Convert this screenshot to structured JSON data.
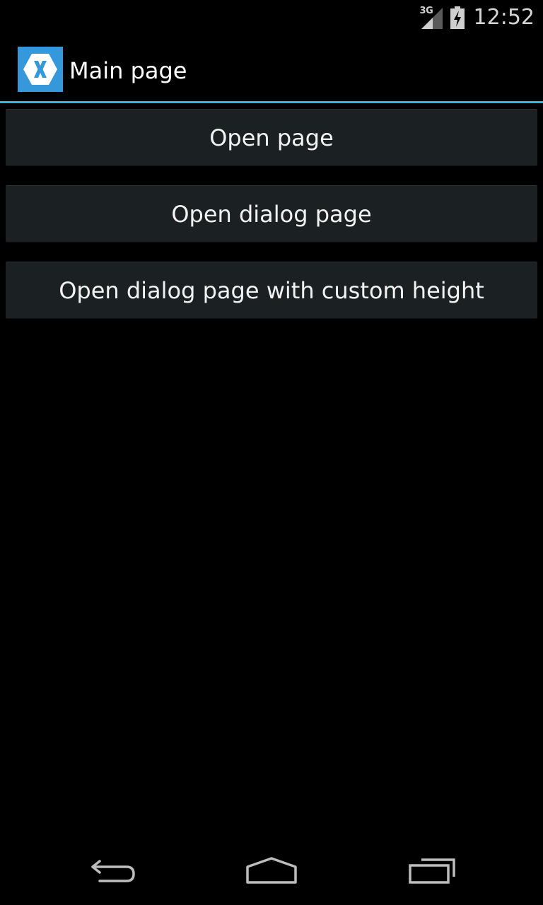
{
  "status_bar": {
    "network_label": "3G",
    "time": "12:52",
    "icons": [
      "signal-icon",
      "battery-icon"
    ]
  },
  "action_bar": {
    "title": "Main page",
    "app_icon": "xamarin-logo-icon",
    "accent_color": "#33b5e5",
    "icon_color": "#3498db"
  },
  "buttons": [
    {
      "label": "Open page"
    },
    {
      "label": "Open dialog page"
    },
    {
      "label": "Open dialog page with custom height"
    }
  ],
  "nav_bar": {
    "icons": [
      "back-icon",
      "home-icon",
      "recent-apps-icon"
    ]
  }
}
